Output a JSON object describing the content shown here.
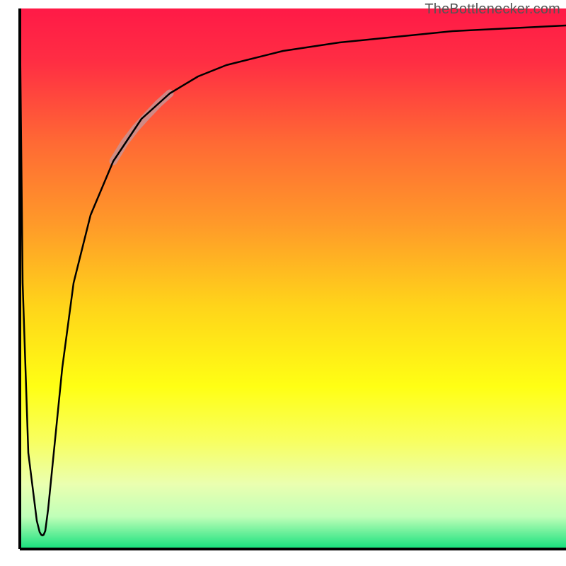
{
  "attribution": "TheBottlenecker.com",
  "chart_data": {
    "type": "line",
    "title": "",
    "xlabel": "",
    "ylabel": "",
    "xlim": [
      0,
      100
    ],
    "ylim": [
      0,
      100
    ],
    "background_gradient_stops": [
      {
        "offset": 0.0,
        "color": "#ff1a47"
      },
      {
        "offset": 0.1,
        "color": "#ff2e43"
      },
      {
        "offset": 0.25,
        "color": "#ff6a34"
      },
      {
        "offset": 0.4,
        "color": "#ff9a29"
      },
      {
        "offset": 0.55,
        "color": "#ffd41a"
      },
      {
        "offset": 0.7,
        "color": "#ffff14"
      },
      {
        "offset": 0.8,
        "color": "#f8ff60"
      },
      {
        "offset": 0.88,
        "color": "#eaffb0"
      },
      {
        "offset": 0.94,
        "color": "#c0ffb8"
      },
      {
        "offset": 1.0,
        "color": "#14e07c"
      }
    ],
    "axis_color": "#000000",
    "axis_inner": {
      "x0": 3.5,
      "y0": 3.0,
      "x1": 100,
      "y1": 98.5
    },
    "series": [
      {
        "name": "curve",
        "color": "#000000",
        "width": 2.5,
        "x": [
          3.5,
          4.0,
          5.0,
          6.5,
          7.0,
          7.3,
          7.5,
          7.7,
          8.0,
          8.5,
          9.5,
          11,
          13,
          16,
          20,
          25,
          30,
          35,
          40,
          50,
          60,
          70,
          80,
          90,
          100
        ],
        "y": [
          97.5,
          50.0,
          20.0,
          8.0,
          6.0,
          5.5,
          5.4,
          5.5,
          6.2,
          10.0,
          20.0,
          35.0,
          50.0,
          62.0,
          71.5,
          79.0,
          83.5,
          86.5,
          88.5,
          91.0,
          92.5,
          93.5,
          94.5,
          95.0,
          95.5
        ]
      }
    ],
    "highlight": {
      "color": "#c99292",
      "opacity": 0.85,
      "width": 11,
      "x": [
        20,
        22,
        24,
        26,
        28,
        30
      ],
      "y": [
        71.5,
        74.8,
        77.4,
        79.6,
        81.7,
        83.5
      ]
    }
  }
}
